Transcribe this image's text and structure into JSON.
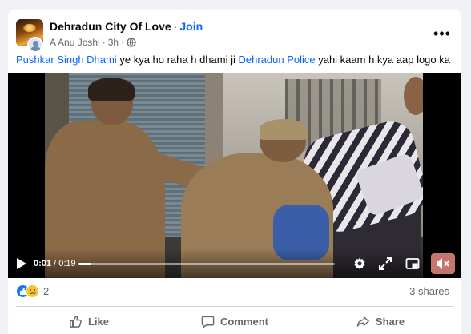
{
  "post": {
    "group_name": "Dehradun City Of Love",
    "separator": "·",
    "join_label": "Join",
    "author": "A Anu Joshi",
    "time": "3h",
    "more_label": "•••",
    "text": {
      "mention1": "Pushkar Singh Dhami",
      "part1": " ye kya ho raha h dhami ji ",
      "mention2": "Dehradun Police",
      "part2": " yahi kaam h kya aap logo ka"
    }
  },
  "video": {
    "current_time": "0:01",
    "duration": "0:19",
    "time_separator": " / ",
    "progress": 0.05,
    "muted": true,
    "icons": [
      "play-icon",
      "settings-icon",
      "fullscreen-icon",
      "picture-in-picture-icon",
      "muted-icon"
    ]
  },
  "engagement": {
    "reaction_icons": [
      "like-icon",
      "sad-icon"
    ],
    "reaction_count": "2",
    "shares": "3 shares"
  },
  "actions": {
    "like": "Like",
    "comment": "Comment",
    "share": "Share"
  },
  "colors": {
    "link": "#0866ff",
    "secondary_text": "#65676b",
    "background": "#f0f2f5"
  }
}
